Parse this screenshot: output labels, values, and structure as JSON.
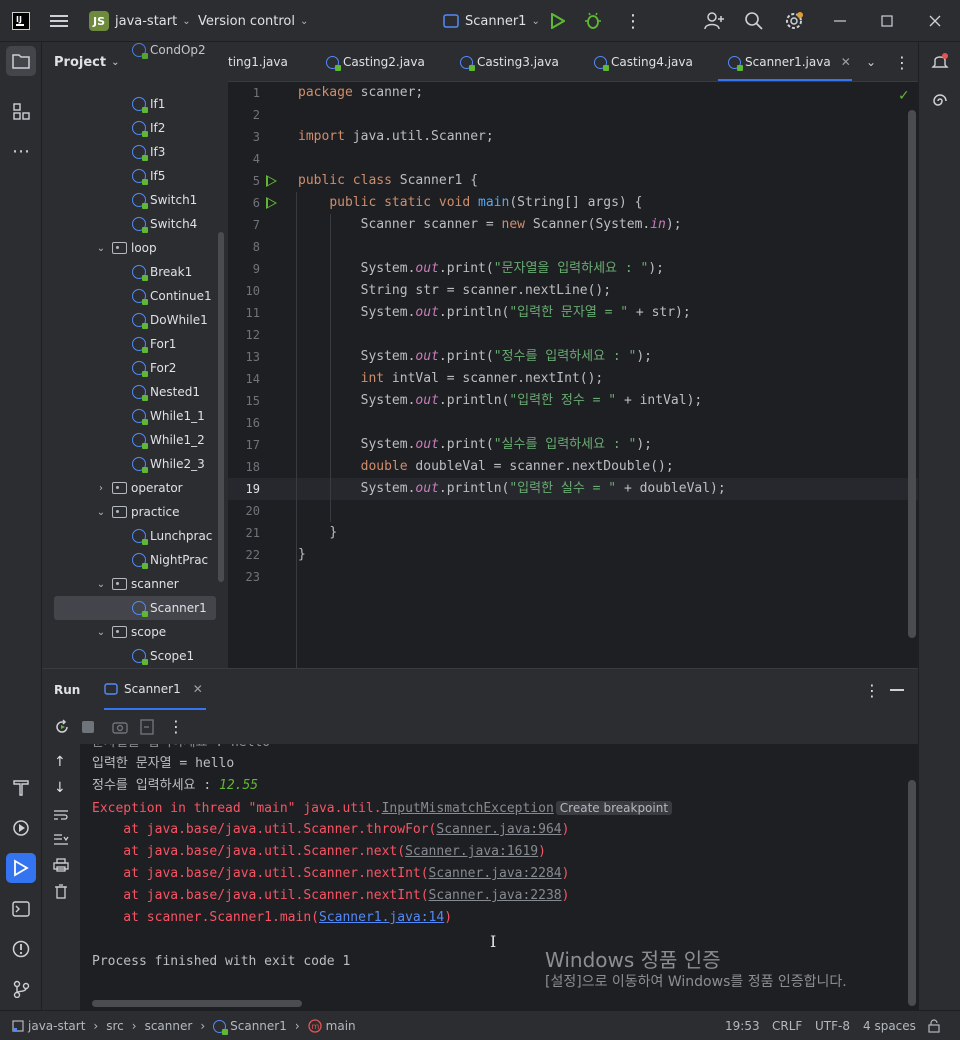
{
  "titlebar": {
    "project_badge": "JS",
    "project_name": "java-start",
    "vcs": "Version control",
    "run_config": "Scanner1"
  },
  "project_panel": {
    "title": "Project",
    "items": [
      {
        "label": "CondOp2",
        "kind": "class"
      },
      {
        "label": "If1",
        "kind": "class"
      },
      {
        "label": "If2",
        "kind": "class"
      },
      {
        "label": "If3",
        "kind": "class"
      },
      {
        "label": "If5",
        "kind": "class"
      },
      {
        "label": "Switch1",
        "kind": "class"
      },
      {
        "label": "Switch4",
        "kind": "class"
      },
      {
        "label": "loop",
        "kind": "folder-open"
      },
      {
        "label": "Break1",
        "kind": "class"
      },
      {
        "label": "Continue1",
        "kind": "class"
      },
      {
        "label": "DoWhile1",
        "kind": "class"
      },
      {
        "label": "For1",
        "kind": "class"
      },
      {
        "label": "For2",
        "kind": "class"
      },
      {
        "label": "Nested1",
        "kind": "class"
      },
      {
        "label": "While1_1",
        "kind": "class"
      },
      {
        "label": "While1_2",
        "kind": "class"
      },
      {
        "label": "While2_3",
        "kind": "class"
      },
      {
        "label": "operator",
        "kind": "folder-closed"
      },
      {
        "label": "practice",
        "kind": "folder-open"
      },
      {
        "label": "Lunchprac",
        "kind": "class"
      },
      {
        "label": "NightPrac",
        "kind": "class"
      },
      {
        "label": "scanner",
        "kind": "folder-open"
      },
      {
        "label": "Scanner1",
        "kind": "class",
        "selected": true
      },
      {
        "label": "scope",
        "kind": "folder-open"
      },
      {
        "label": "Scope1",
        "kind": "class"
      }
    ]
  },
  "tabs": [
    "ting1.java",
    "Casting2.java",
    "Casting3.java",
    "Casting4.java",
    "Scanner1.java"
  ],
  "editor": {
    "line_numbers": [
      "1",
      "2",
      "3",
      "4",
      "5",
      "6",
      "7",
      "8",
      "9",
      "10",
      "11",
      "12",
      "13",
      "14",
      "15",
      "16",
      "17",
      "18",
      "19",
      "20",
      "21",
      "22",
      "23"
    ],
    "lines": {
      "l1_kw": "package",
      "l1_rest": " scanner;",
      "l3_kw": "import",
      "l3_rest": " java.util.Scanner;",
      "l5_kw": "public class",
      "l5_rest": " Scanner1 {",
      "l6_kw": "public static void",
      "l6_fn": "main",
      "l6_rest": "(String[] args) {",
      "l7_a": "Scanner scanner = ",
      "l7_kw": "new",
      "l7_b": " Scanner(System.",
      "l7_st": "in",
      "l7_c": ");",
      "l9_a": "System.",
      "l9_st": "out",
      "l9_b": ".print(",
      "l9_str": "\"문자열을 입력하세요 : \"",
      "l9_c": ");",
      "l10": "String str = scanner.nextLine();",
      "l11_a": "System.",
      "l11_st": "out",
      "l11_b": ".println(",
      "l11_str": "\"입력한 문자열 = \"",
      "l11_c": " + str);",
      "l13_a": "System.",
      "l13_st": "out",
      "l13_b": ".print(",
      "l13_str": "\"정수를 입력하세요 : \"",
      "l13_c": ");",
      "l14_kw": "int",
      "l14_rest": " intVal = scanner.nextInt();",
      "l15_a": "System.",
      "l15_st": "out",
      "l15_b": ".println(",
      "l15_str": "\"입력한 정수 = \"",
      "l15_c": " + intVal);",
      "l17_a": "System.",
      "l17_st": "out",
      "l17_b": ".print(",
      "l17_str": "\"실수를 입력하세요 : \"",
      "l17_c": ");",
      "l18_kw": "double",
      "l18_rest": " doubleVal = scanner.nextDouble();",
      "l19_a": "System.",
      "l19_st": "out",
      "l19_b": ".println(",
      "l19_str": "\"입력한 실수 = \"",
      "l19_c": " + doubleVal);",
      "l21": "}",
      "l22": "}"
    }
  },
  "run_panel": {
    "title": "Run",
    "tab": "Scanner1",
    "console": {
      "partial_top": "문자열을 입력하세요 : hello",
      "line_str_result": "입력한 문자열 = hello",
      "prompt_int": "정수를 입력하세요 : ",
      "input_int": "12.55",
      "exception_a": "Exception in thread \"main\" java.util.",
      "exception_link": "InputMismatchException",
      "breakpoint_hint": "Create breakpoint",
      "stack": [
        {
          "prefix": "    at java.base/java.util.Scanner.throwFor(",
          "link": "Scanner.java:964",
          "suffix": ")"
        },
        {
          "prefix": "    at java.base/java.util.Scanner.next(",
          "link": "Scanner.java:1619",
          "suffix": ")"
        },
        {
          "prefix": "    at java.base/java.util.Scanner.nextInt(",
          "link": "Scanner.java:2284",
          "suffix": ")"
        },
        {
          "prefix": "    at java.base/java.util.Scanner.nextInt(",
          "link": "Scanner.java:2238",
          "suffix": ")"
        },
        {
          "prefix": "    at scanner.Scanner1.main(",
          "link": "Scanner1.java:14",
          "suffix": ")"
        }
      ],
      "finished": "Process finished with exit code 1"
    },
    "watermark_title": "Windows 정품 인증",
    "watermark_text": "[설정]으로 이동하여 Windows를 정품 인증합니다."
  },
  "statusbar": {
    "breadcrumb": [
      "java-start",
      "src",
      "scanner",
      "Scanner1",
      "main"
    ],
    "position": "19:53",
    "line_sep": "CRLF",
    "encoding": "UTF-8",
    "indent": "4 spaces"
  },
  "colors": {
    "accent": "#3574f0",
    "keyword": "#cf8e6d",
    "string": "#6aab73",
    "function": "#56a8f5",
    "error": "#f75464",
    "run_green": "#5fb832"
  }
}
